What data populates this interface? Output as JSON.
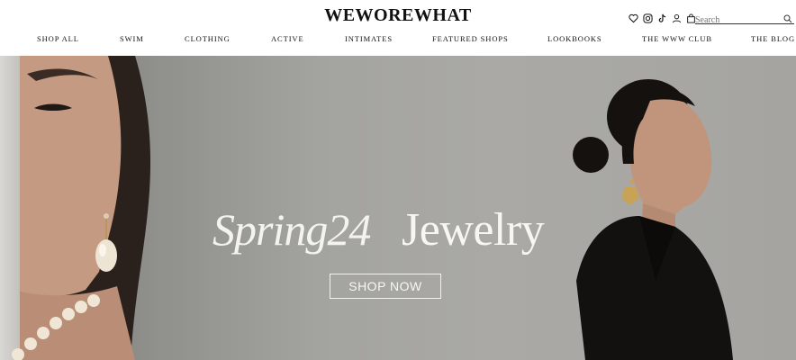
{
  "brand": {
    "logo_text": "WEWOREWHAT"
  },
  "header_icons": [
    "heart-icon",
    "instagram-icon",
    "tiktok-icon",
    "account-icon",
    "shopping-bag-icon"
  ],
  "search": {
    "placeholder": "Search",
    "icon": "search-icon"
  },
  "nav": {
    "items": [
      {
        "label": "SHOP ALL"
      },
      {
        "label": "SWIM"
      },
      {
        "label": "CLOTHING"
      },
      {
        "label": "ACTIVE"
      },
      {
        "label": "INTIMATES"
      },
      {
        "label": "FEATURED SHOPS"
      },
      {
        "label": "LOOKBOOKS"
      },
      {
        "label": "THE WWW CLUB"
      },
      {
        "label": "THE BLOG"
      }
    ]
  },
  "hero": {
    "headline_script": "Spring24",
    "headline_bold": "Jewelry",
    "cta_label": "SHOP NOW"
  },
  "colors": {
    "text": "#111111",
    "hero_text": "#f7f6f3",
    "hero_bg": "#a5a4a0"
  }
}
